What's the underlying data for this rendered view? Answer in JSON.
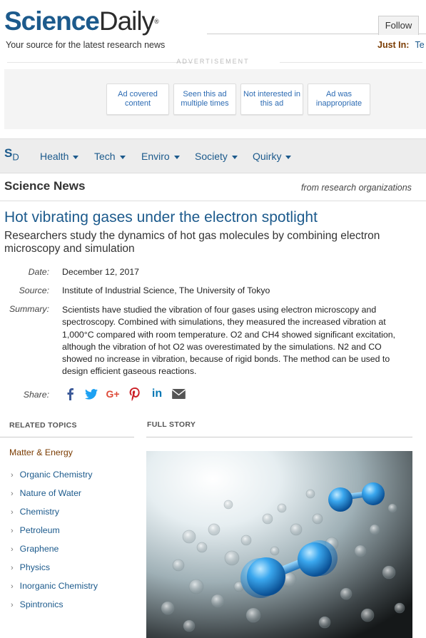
{
  "header": {
    "logo_science": "Science",
    "logo_daily": "Daily",
    "logo_reg": "®",
    "tagline": "Your source for the latest research news",
    "follow_label": "Follow",
    "just_in_label": "Just In:",
    "just_in_text": "Te"
  },
  "ad": {
    "label": "ADVERTISEMENT",
    "buttons": [
      "Ad covered content",
      "Seen this ad multiple times",
      "Not interested in this ad",
      "Ad was inappropriate"
    ]
  },
  "nav": {
    "logo_s": "S",
    "logo_d": "D",
    "items": [
      "Health",
      "Tech",
      "Enviro",
      "Society",
      "Quirky"
    ]
  },
  "section": {
    "title": "Science News",
    "subtitle": "from research organizations"
  },
  "article": {
    "headline": "Hot vibrating gases under the electron spotlight",
    "subheadline": "Researchers study the dynamics of hot gas molecules by combining electron microscopy and simulation",
    "date_label": "Date:",
    "date": "December 12, 2017",
    "source_label": "Source:",
    "source": "Institute of Industrial Science, The University of Tokyo",
    "summary_label": "Summary:",
    "summary": "Scientists have studied the vibration of four gases using electron microscopy and spectroscopy. Combined with simulations, they measured the increased vibration at 1,000°C compared with room temperature. O2 and CH4 showed significant excitation, although the vibration of hot O2 was overestimated by the simulations. N2 and CO showed no increase in vibration, because of rigid bonds. The method can be used to design efficient gaseous reactions.",
    "share_label": "Share:"
  },
  "share_icons": [
    {
      "name": "facebook-icon",
      "glyph": "f",
      "color": "#3b5998"
    },
    {
      "name": "twitter-icon",
      "glyph": "🐦",
      "color": "#1da1f2"
    },
    {
      "name": "google-plus-icon",
      "glyph": "G+",
      "color": "#dd4b39"
    },
    {
      "name": "pinterest-icon",
      "glyph": "P",
      "color": "#cb2027"
    },
    {
      "name": "linkedin-icon",
      "glyph": "in",
      "color": "#0077b5"
    },
    {
      "name": "email-icon",
      "glyph": "✉",
      "color": "#555555"
    }
  ],
  "related": {
    "heading": "RELATED TOPICS",
    "category": "Matter & Energy",
    "items": [
      "Organic Chemistry",
      "Nature of Water",
      "Chemistry",
      "Petroleum",
      "Graphene",
      "Physics",
      "Inorganic Chemistry",
      "Spintronics"
    ]
  },
  "full_story": {
    "heading": "FULL STORY"
  },
  "colors": {
    "brand_blue": "#1c5a8c",
    "accent_brown": "#7a3b00"
  }
}
